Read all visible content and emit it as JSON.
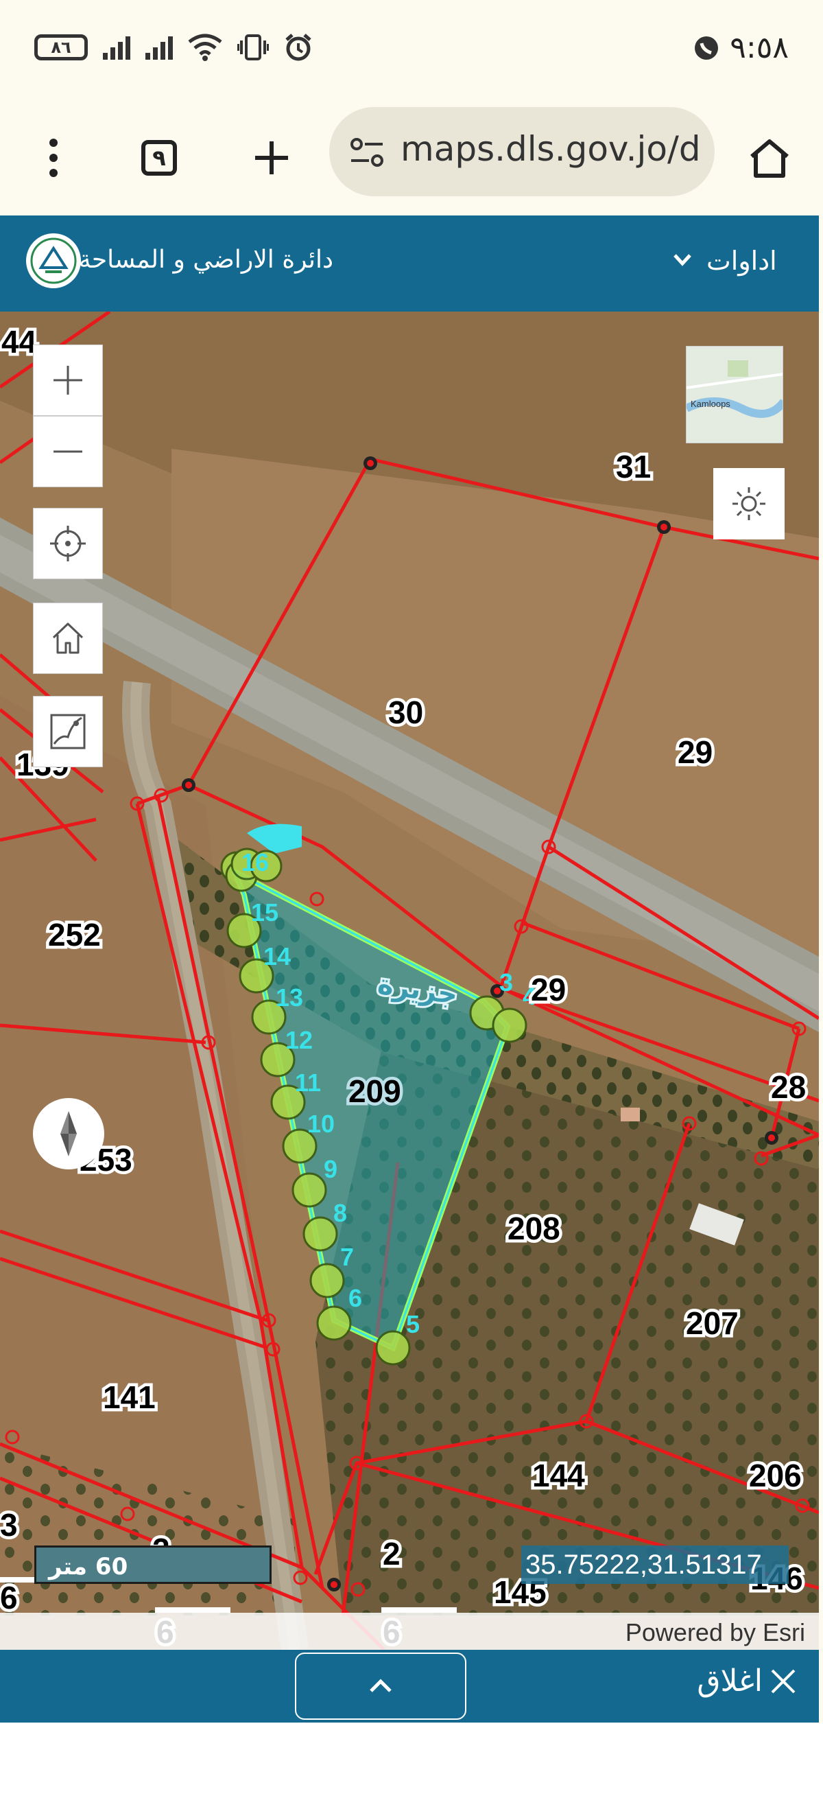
{
  "status_bar": {
    "battery": "٨٦",
    "time": "٩:٥٨"
  },
  "browser": {
    "tab_count": "٩",
    "url": "maps.dls.gov.jo/d"
  },
  "app": {
    "title": "دائرة الاراضي و المساحة",
    "tools_label": "اداوات"
  },
  "map": {
    "parcel_labels": [
      {
        "text": "44",
        "id": "p44"
      },
      {
        "text": "31",
        "id": "p31"
      },
      {
        "text": "30",
        "id": "p30"
      },
      {
        "text": "29",
        "id": "p29a"
      },
      {
        "text": "139",
        "id": "p139"
      },
      {
        "text": "252",
        "id": "p252"
      },
      {
        "text": "29",
        "id": "p29b"
      },
      {
        "text": "28",
        "id": "p28"
      },
      {
        "text": "253",
        "id": "p253"
      },
      {
        "text": "208",
        "id": "p208"
      },
      {
        "text": "207",
        "id": "p207"
      },
      {
        "text": "141",
        "id": "p141"
      },
      {
        "text": "144",
        "id": "p144"
      },
      {
        "text": "206",
        "id": "p206"
      },
      {
        "text": "3",
        "id": "p3"
      },
      {
        "text": "2",
        "id": "p2a"
      },
      {
        "text": "2",
        "id": "p2b"
      },
      {
        "text": "145",
        "id": "p145"
      },
      {
        "text": "146",
        "id": "p146"
      },
      {
        "text": "6",
        "id": "p6a"
      },
      {
        "text": "6",
        "id": "p6b"
      },
      {
        "text": "6",
        "id": "p6c"
      }
    ],
    "selected_parcel": "209",
    "selected_parcel_arabic": "جزيرة",
    "vertex_labels": [
      "16",
      "15",
      "14",
      "13",
      "12",
      "11",
      "10",
      "9",
      "8",
      "7",
      "6",
      "5",
      "4",
      "3"
    ],
    "scale_text": "60 متر",
    "coordinates": "35.75222,31.51317",
    "attribution": "Powered by Esri",
    "basemap_thumb_text": "Kamloops"
  },
  "bottom_bar": {
    "close_label": "اغلاق"
  },
  "colors": {
    "header": "#13698f",
    "parcel_lines": "#e8191b",
    "selection_fill": "#1aa8b4",
    "selection_outline": "#9aff5e",
    "vertex_fill": "#a8d64a"
  },
  "icons": [
    "zoom-in-icon",
    "zoom-out-icon",
    "locate-icon",
    "home-icon",
    "measure-icon",
    "compass-icon",
    "sun-icon",
    "chevron-up-icon",
    "close-icon",
    "chevron-down-icon"
  ]
}
